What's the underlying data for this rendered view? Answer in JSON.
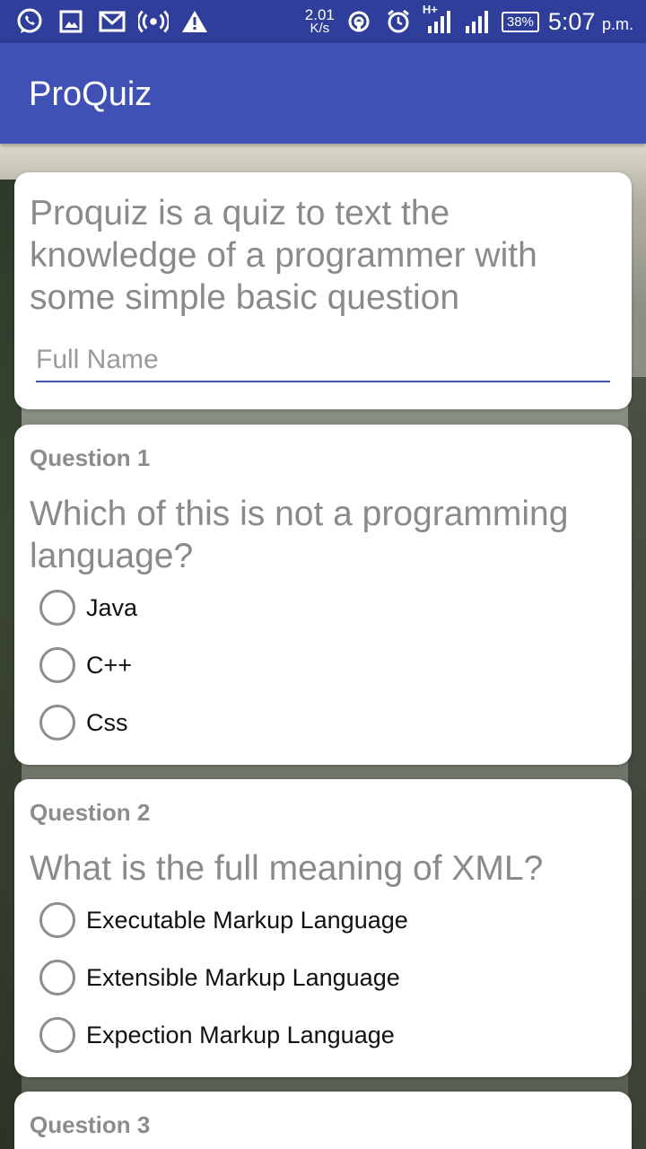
{
  "status_bar": {
    "speed_value": "2.01",
    "speed_unit": "K/s",
    "network": "H+",
    "battery": "38%",
    "time": "5:07",
    "time_suffix": "p.m."
  },
  "app_bar": {
    "title": "ProQuiz"
  },
  "intro": {
    "description": "Proquiz is a quiz to text the knowledge of a programmer with some simple basic question",
    "name_placeholder": "Full Name"
  },
  "questions": [
    {
      "label": "Question 1",
      "text": "Which of this is not a programming language?",
      "options": [
        "Java",
        "C++",
        "Css"
      ]
    },
    {
      "label": "Question 2",
      "text": "What is the full meaning of XML?",
      "options": [
        "Executable Markup Language",
        "Extensible Markup Language",
        "Expection Markup Language"
      ]
    },
    {
      "label": "Question 3"
    }
  ],
  "colors": {
    "primary": "#3f51b5",
    "primary_dark": "#2e3e9a"
  }
}
